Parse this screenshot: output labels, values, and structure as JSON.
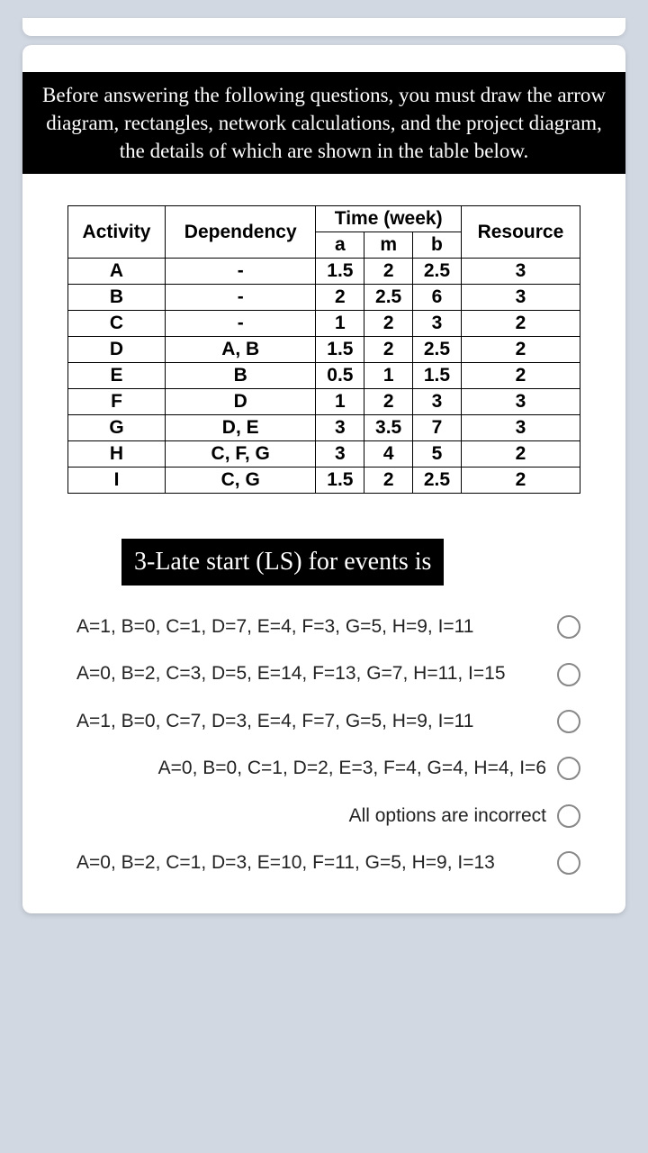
{
  "intro": "Before answering the following questions, you must draw the arrow diagram, rectangles, network calculations, and the project diagram, the details of which are shown in the table below.",
  "table": {
    "headers": {
      "activity": "Activity",
      "dependency": "Dependency",
      "time_group": "Time (week)",
      "a": "a",
      "m": "m",
      "b": "b",
      "resource": "Resource"
    },
    "rows": [
      {
        "activity": "A",
        "dependency": "-",
        "a": "1.5",
        "m": "2",
        "b": "2.5",
        "resource": "3"
      },
      {
        "activity": "B",
        "dependency": "-",
        "a": "2",
        "m": "2.5",
        "b": "6",
        "resource": "3"
      },
      {
        "activity": "C",
        "dependency": "-",
        "a": "1",
        "m": "2",
        "b": "3",
        "resource": "2"
      },
      {
        "activity": "D",
        "dependency": "A, B",
        "a": "1.5",
        "m": "2",
        "b": "2.5",
        "resource": "2"
      },
      {
        "activity": "E",
        "dependency": "B",
        "a": "0.5",
        "m": "1",
        "b": "1.5",
        "resource": "2"
      },
      {
        "activity": "F",
        "dependency": "D",
        "a": "1",
        "m": "2",
        "b": "3",
        "resource": "3"
      },
      {
        "activity": "G",
        "dependency": "D, E",
        "a": "3",
        "m": "3.5",
        "b": "7",
        "resource": "3"
      },
      {
        "activity": "H",
        "dependency": "C, F, G",
        "a": "3",
        "m": "4",
        "b": "5",
        "resource": "2"
      },
      {
        "activity": "I",
        "dependency": "C, G",
        "a": "1.5",
        "m": "2",
        "b": "2.5",
        "resource": "2"
      }
    ]
  },
  "question": {
    "title": "3-Late start (LS) for events is",
    "options": [
      "A=1, B=0, C=1, D=7, E=4, F=3, G=5, H=9, I=11",
      "A=0, B=2, C=3, D=5, E=14, F=13, G=7, H=11, I=15",
      "A=1, B=0, C=7, D=3, E=4, F=7, G=5, H=9, I=11",
      "A=0, B=0, C=1, D=2, E=3, F=4, G=4, H=4, I=6",
      "All options are incorrect",
      "A=0, B=2, C=1, D=3, E=10, F=11, G=5, H=9, I=13"
    ]
  }
}
